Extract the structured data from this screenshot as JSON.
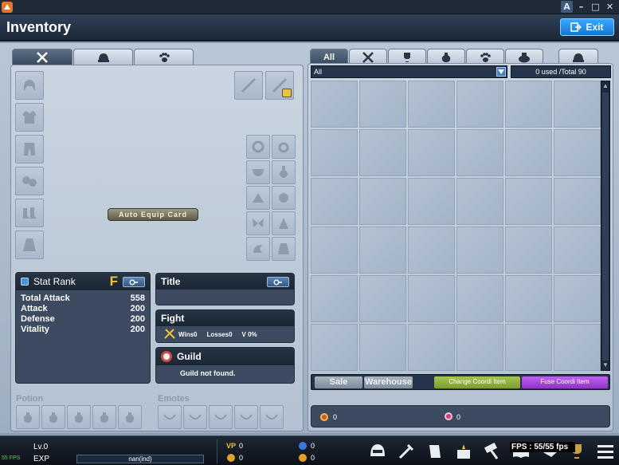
{
  "window": {
    "lang_label": "A",
    "minimize": "–",
    "maximize": "□",
    "close": "✕"
  },
  "header": {
    "title": "Inventory",
    "exit_label": "Exit"
  },
  "equip_tabs": [
    {
      "icon": "crossed-swords-icon"
    },
    {
      "icon": "helmet-icon"
    },
    {
      "icon": "paw-icon"
    }
  ],
  "auto_equip_label": "Auto Equip Card",
  "stat": {
    "title": "Stat Rank",
    "rank": "F",
    "rows": [
      {
        "label": "Total Attack",
        "value": "558"
      },
      {
        "label": "Attack",
        "value": "200"
      },
      {
        "label": "Defense",
        "value": "200"
      },
      {
        "label": "Vitality",
        "value": "200"
      }
    ]
  },
  "title_card": {
    "title": "Title"
  },
  "fight": {
    "title": "Fight",
    "wins": "Wins0",
    "losses": "Losses0",
    "ratio": "V 0%"
  },
  "guild": {
    "title": "Guild",
    "status": "Guild not found."
  },
  "potion_label": "Potion",
  "emotes_label": "Emotes",
  "inv_tabs": [
    {
      "label": "All",
      "icon": ""
    },
    {
      "label": "",
      "icon": "crossed-swords-icon"
    },
    {
      "label": "",
      "icon": "trophy-icon"
    },
    {
      "label": "",
      "icon": "potion-icon"
    },
    {
      "label": "",
      "icon": "paw-icon"
    },
    {
      "label": "",
      "icon": "bag-icon"
    },
    {
      "label": "",
      "icon": "helmet-icon"
    }
  ],
  "filter": {
    "selected": "All"
  },
  "capacity": "0 used /Total 90",
  "buttons": {
    "sale": "Sale",
    "warehouse": "Warehouse",
    "change_coordi": "Change Coordi Item",
    "fuse_coordi": "Fuse Coordi Item"
  },
  "currency": {
    "a": "0",
    "b": "0"
  },
  "status": {
    "fps_small": "55 FPS",
    "level": "Lv.0",
    "exp_label": "EXP",
    "exp_value": "nan(ind)",
    "vp_label": "VP",
    "vp": "0",
    "gold": "0",
    "c1": "0",
    "c2": "0",
    "fps": "FPS : 55/55 fps"
  },
  "colors": {
    "accent": "#0f78d8",
    "rank": "#f2c230",
    "change_coordi": "#8db43a",
    "fuse_coordi": "#a63fd9"
  }
}
